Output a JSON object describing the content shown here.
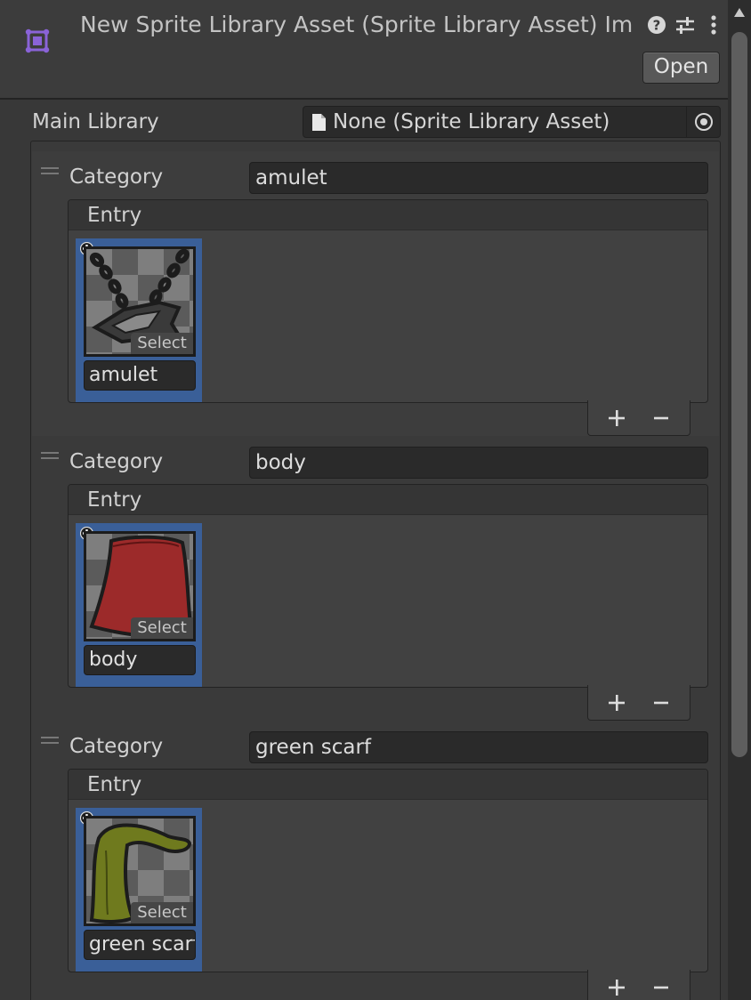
{
  "header": {
    "title": "New Sprite Library Asset (Sprite Library Asset) Im",
    "asset_icon": "sprite-library-asset-icon",
    "icons": [
      "help-icon",
      "preset-sliders-icon",
      "kebab-menu-icon"
    ],
    "open_label": "Open"
  },
  "main_library": {
    "label": "Main Library",
    "value": "None (Sprite Library Asset)",
    "doc_icon": "document-icon",
    "picker_icon": "object-picker-icon"
  },
  "categories": [
    {
      "label": "Category",
      "name": "amulet",
      "entry_header": "Entry",
      "entries": [
        {
          "name": "amulet",
          "select_label": "Select",
          "sprite": "amulet-sprite"
        }
      ]
    },
    {
      "label": "Category",
      "name": "body",
      "entry_header": "Entry",
      "entries": [
        {
          "name": "body",
          "select_label": "Select",
          "sprite": "body-sprite"
        }
      ]
    },
    {
      "label": "Category",
      "name": "green scarf",
      "entry_header": "Entry",
      "entries": [
        {
          "name": "green scarf",
          "select_label": "Select",
          "sprite": "green-scarf-sprite"
        }
      ]
    }
  ],
  "list_controls": {
    "add_icon": "plus-icon",
    "remove_icon": "minus-icon"
  },
  "colors": {
    "selection": "#3a5f98",
    "panel": "#383838",
    "field": "#2a2a2a",
    "body_sprite": "#9c2a2a",
    "scarf_sprite": "#6f7a1e"
  }
}
